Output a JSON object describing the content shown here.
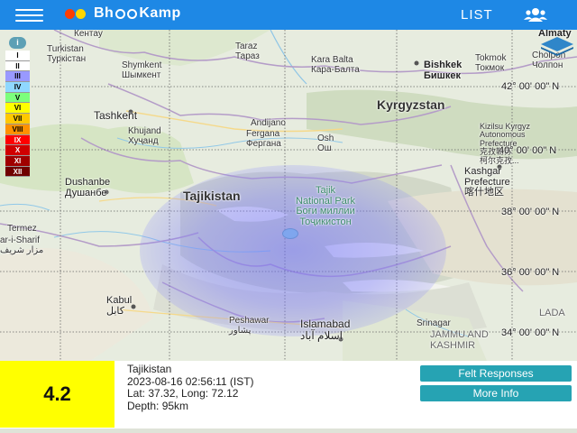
{
  "header": {
    "brand_left": "Bh",
    "brand_right": "Kamp",
    "list_label": "LIST"
  },
  "colors": {
    "topbar": "#1e88e5",
    "magnitude_box": "#ffff00",
    "button": "#26a3b3",
    "intensity_overlay": "#7070ff"
  },
  "legend": {
    "info": "i",
    "levels": [
      {
        "label": "I",
        "color": "#ffffff",
        "text": "#000"
      },
      {
        "label": "II",
        "color": "#ffffff",
        "text": "#000"
      },
      {
        "label": "III",
        "color": "#9999ff",
        "text": "#000"
      },
      {
        "label": "IV",
        "color": "#8fd8ff",
        "text": "#000"
      },
      {
        "label": "V",
        "color": "#7cff7c",
        "text": "#000"
      },
      {
        "label": "VI",
        "color": "#ffff00",
        "text": "#000"
      },
      {
        "label": "VII",
        "color": "#ffc800",
        "text": "#000"
      },
      {
        "label": "VIII",
        "color": "#ff9100",
        "text": "#000"
      },
      {
        "label": "IX",
        "color": "#ff0000",
        "text": "#fff"
      },
      {
        "label": "X",
        "color": "#d00000",
        "text": "#fff"
      },
      {
        "label": "XI",
        "color": "#a00000",
        "text": "#fff"
      },
      {
        "label": "XII",
        "color": "#700000",
        "text": "#fff"
      }
    ]
  },
  "map": {
    "labels": {
      "kentau": "Кентау",
      "turkistan": "Turkistan\nТуркістан",
      "taraz": "Taraz\nТараз",
      "almaty": "Almaty",
      "shymkent": "Shymkent\nШымкент",
      "karabalta": "Kara Balta\nКара-Балта",
      "bishkek": "Bishkek\nБишкек",
      "tokmok": "Tokmok\nТокмок",
      "cholpon": "Cholpon\nЧолпон",
      "tashkent": "Tashkent",
      "kyrgyzstan": "Kyrgyzstan",
      "andijano": "Andijano",
      "khujand": "Khujand\nХуҷанд",
      "fergana": "Fergana\nФергана",
      "osh": "Osh\nОш",
      "kizilsu": "Kizilsu Kyrgyz\nAutonomous\nPrefecture\n克孜勒苏\n柯尔克孜...",
      "kashgar": "Kashgar\nPrefecture\n喀什地区",
      "dushanbe": "Dushanbe\nДушанбе",
      "tajikistan": "Tajikistan",
      "tajik_park": "Tajik\nNational Park\nБоғи миллии\nТоҷикистон",
      "termez": "Termez",
      "mazar": "ar-i-Sharif\nمزار شریف",
      "kabul": "Kabul\nکابل",
      "peshawar": "Peshawar\nپشاور",
      "islamabad": "Islamabad\nاسلام آباد",
      "srinagar": "Srinagar",
      "ladakh": "LADA",
      "jammu": "JAMMU AND\nKASHMIR"
    },
    "grid_labels": {
      "lat42": "42° 00' 00\" N",
      "lat40": "40° 00' 00\" N",
      "lat38": "38° 00' 00\" N",
      "lat36": "36° 00' 00\" N",
      "lat34": "34° 00' 00\" N"
    }
  },
  "event": {
    "magnitude": "4.2",
    "region": "Tajikistan",
    "datetime": "2023-08-16 02:56:11 (IST)",
    "coords": "Lat: 37.32, Long: 72.12",
    "depth": "Depth: 95km"
  },
  "buttons": {
    "felt": "Felt Responses",
    "more": "More Info"
  }
}
